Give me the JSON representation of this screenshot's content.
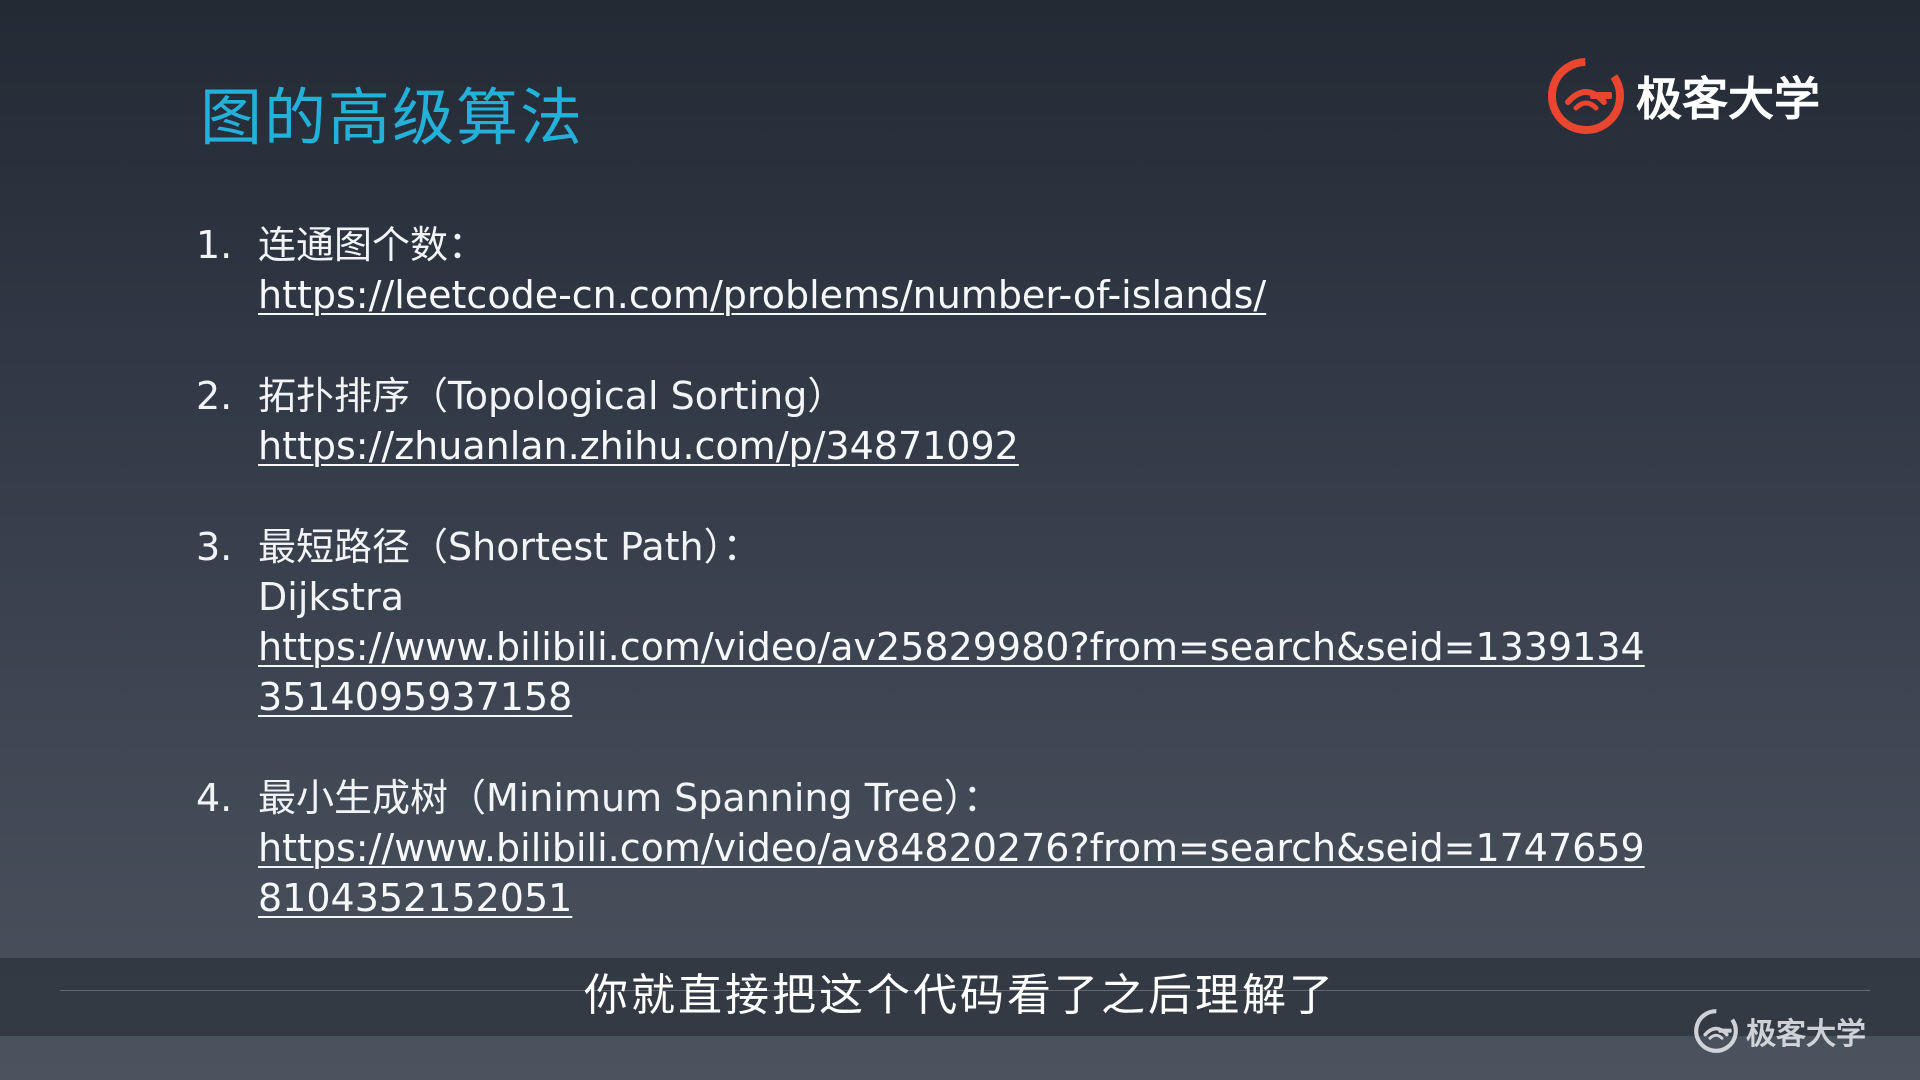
{
  "slide": {
    "title": "图的高级算法"
  },
  "brand": {
    "name": "极客大学",
    "accent_color": "#e9452f",
    "icon": "geektime-logo-icon"
  },
  "items": [
    {
      "num": "1.",
      "lines": [
        "连通图个数："
      ],
      "link": "https://leetcode-cn.com/problems/number-of-islands/"
    },
    {
      "num": "2.",
      "lines": [
        "拓扑排序（Topological Sorting）"
      ],
      "link": "https://zhuanlan.zhihu.com/p/34871092"
    },
    {
      "num": "3.",
      "lines": [
        "最短路径（Shortest Path）：",
        "Dijkstra"
      ],
      "link": "https://www.bilibili.com/video/av25829980?from=search&seid=1339134\n3514095937158"
    },
    {
      "num": "4.",
      "lines": [
        "最小生成树（Minimum Spanning Tree）："
      ],
      "link": "https://www.bilibili.com/video/av84820276?from=search&seid=1747659\n8104352152051"
    }
  ],
  "subtitle": {
    "text": "你就直接把这个代码看了之后理解了"
  },
  "watermark": {
    "name": "极客大学",
    "icon": "geektime-logo-icon"
  },
  "colors": {
    "title": "#23b0d9",
    "text": "#f1f3f5"
  }
}
